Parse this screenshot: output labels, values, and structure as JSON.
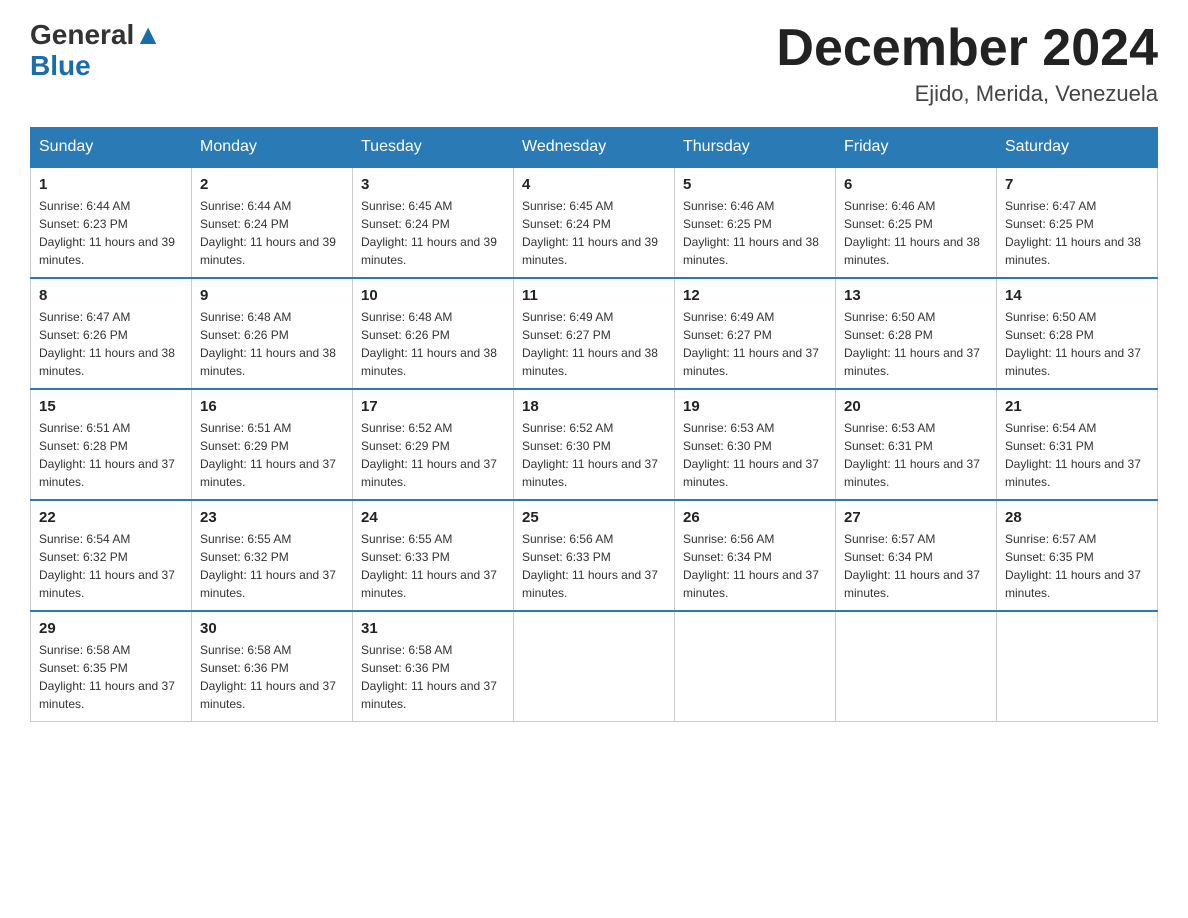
{
  "header": {
    "logo_general": "General",
    "logo_blue": "Blue",
    "month_title": "December 2024",
    "location": "Ejido, Merida, Venezuela"
  },
  "days_of_week": [
    "Sunday",
    "Monday",
    "Tuesday",
    "Wednesday",
    "Thursday",
    "Friday",
    "Saturday"
  ],
  "weeks": [
    [
      {
        "day": "1",
        "sunrise": "6:44 AM",
        "sunset": "6:23 PM",
        "daylight": "11 hours and 39 minutes."
      },
      {
        "day": "2",
        "sunrise": "6:44 AM",
        "sunset": "6:24 PM",
        "daylight": "11 hours and 39 minutes."
      },
      {
        "day": "3",
        "sunrise": "6:45 AM",
        "sunset": "6:24 PM",
        "daylight": "11 hours and 39 minutes."
      },
      {
        "day": "4",
        "sunrise": "6:45 AM",
        "sunset": "6:24 PM",
        "daylight": "11 hours and 39 minutes."
      },
      {
        "day": "5",
        "sunrise": "6:46 AM",
        "sunset": "6:25 PM",
        "daylight": "11 hours and 38 minutes."
      },
      {
        "day": "6",
        "sunrise": "6:46 AM",
        "sunset": "6:25 PM",
        "daylight": "11 hours and 38 minutes."
      },
      {
        "day": "7",
        "sunrise": "6:47 AM",
        "sunset": "6:25 PM",
        "daylight": "11 hours and 38 minutes."
      }
    ],
    [
      {
        "day": "8",
        "sunrise": "6:47 AM",
        "sunset": "6:26 PM",
        "daylight": "11 hours and 38 minutes."
      },
      {
        "day": "9",
        "sunrise": "6:48 AM",
        "sunset": "6:26 PM",
        "daylight": "11 hours and 38 minutes."
      },
      {
        "day": "10",
        "sunrise": "6:48 AM",
        "sunset": "6:26 PM",
        "daylight": "11 hours and 38 minutes."
      },
      {
        "day": "11",
        "sunrise": "6:49 AM",
        "sunset": "6:27 PM",
        "daylight": "11 hours and 38 minutes."
      },
      {
        "day": "12",
        "sunrise": "6:49 AM",
        "sunset": "6:27 PM",
        "daylight": "11 hours and 37 minutes."
      },
      {
        "day": "13",
        "sunrise": "6:50 AM",
        "sunset": "6:28 PM",
        "daylight": "11 hours and 37 minutes."
      },
      {
        "day": "14",
        "sunrise": "6:50 AM",
        "sunset": "6:28 PM",
        "daylight": "11 hours and 37 minutes."
      }
    ],
    [
      {
        "day": "15",
        "sunrise": "6:51 AM",
        "sunset": "6:28 PM",
        "daylight": "11 hours and 37 minutes."
      },
      {
        "day": "16",
        "sunrise": "6:51 AM",
        "sunset": "6:29 PM",
        "daylight": "11 hours and 37 minutes."
      },
      {
        "day": "17",
        "sunrise": "6:52 AM",
        "sunset": "6:29 PM",
        "daylight": "11 hours and 37 minutes."
      },
      {
        "day": "18",
        "sunrise": "6:52 AM",
        "sunset": "6:30 PM",
        "daylight": "11 hours and 37 minutes."
      },
      {
        "day": "19",
        "sunrise": "6:53 AM",
        "sunset": "6:30 PM",
        "daylight": "11 hours and 37 minutes."
      },
      {
        "day": "20",
        "sunrise": "6:53 AM",
        "sunset": "6:31 PM",
        "daylight": "11 hours and 37 minutes."
      },
      {
        "day": "21",
        "sunrise": "6:54 AM",
        "sunset": "6:31 PM",
        "daylight": "11 hours and 37 minutes."
      }
    ],
    [
      {
        "day": "22",
        "sunrise": "6:54 AM",
        "sunset": "6:32 PM",
        "daylight": "11 hours and 37 minutes."
      },
      {
        "day": "23",
        "sunrise": "6:55 AM",
        "sunset": "6:32 PM",
        "daylight": "11 hours and 37 minutes."
      },
      {
        "day": "24",
        "sunrise": "6:55 AM",
        "sunset": "6:33 PM",
        "daylight": "11 hours and 37 minutes."
      },
      {
        "day": "25",
        "sunrise": "6:56 AM",
        "sunset": "6:33 PM",
        "daylight": "11 hours and 37 minutes."
      },
      {
        "day": "26",
        "sunrise": "6:56 AM",
        "sunset": "6:34 PM",
        "daylight": "11 hours and 37 minutes."
      },
      {
        "day": "27",
        "sunrise": "6:57 AM",
        "sunset": "6:34 PM",
        "daylight": "11 hours and 37 minutes."
      },
      {
        "day": "28",
        "sunrise": "6:57 AM",
        "sunset": "6:35 PM",
        "daylight": "11 hours and 37 minutes."
      }
    ],
    [
      {
        "day": "29",
        "sunrise": "6:58 AM",
        "sunset": "6:35 PM",
        "daylight": "11 hours and 37 minutes."
      },
      {
        "day": "30",
        "sunrise": "6:58 AM",
        "sunset": "6:36 PM",
        "daylight": "11 hours and 37 minutes."
      },
      {
        "day": "31",
        "sunrise": "6:58 AM",
        "sunset": "6:36 PM",
        "daylight": "11 hours and 37 minutes."
      },
      null,
      null,
      null,
      null
    ]
  ]
}
